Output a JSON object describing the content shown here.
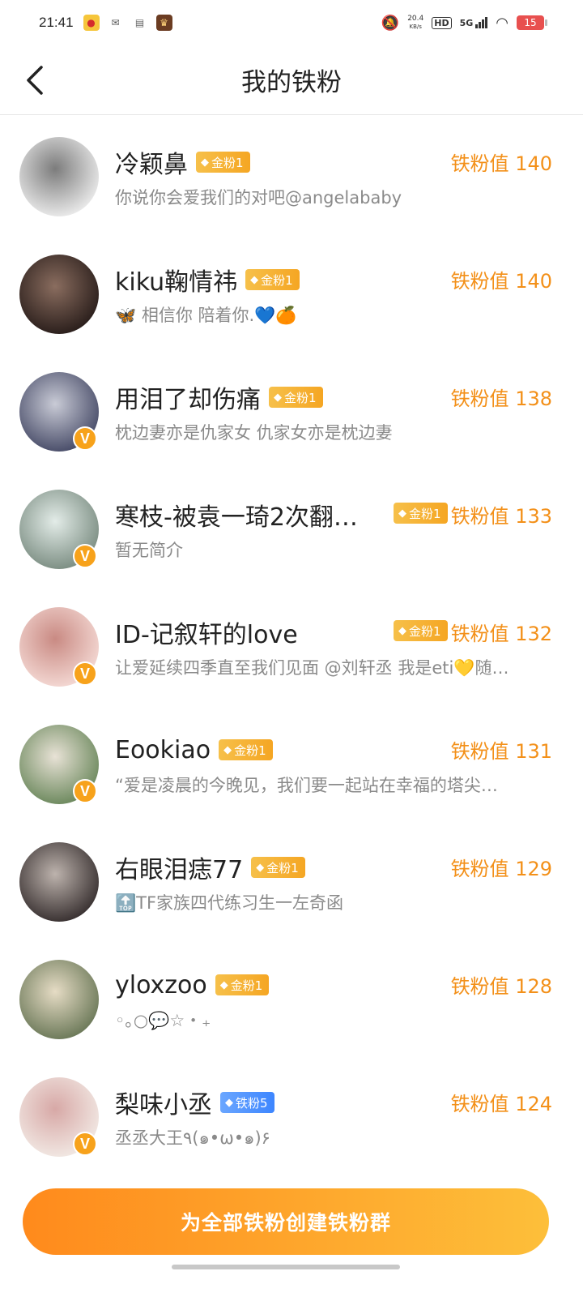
{
  "status_bar": {
    "time": "21:41",
    "speed_value": "20.4",
    "speed_unit": "KB/s",
    "hd": "HD",
    "network": "5G",
    "battery": "15"
  },
  "header": {
    "title": "我的铁粉",
    "back_icon": "chevron-left-icon"
  },
  "fans": [
    {
      "name": "冷颖鼻",
      "badge": "金粉1",
      "badge_type": "gold",
      "score": "铁粉值 140",
      "bio": "你说你会爱我们的对吧@angelababy",
      "verified": false,
      "avatar_colors": [
        "#e9e9e9",
        "#7c7c7c"
      ]
    },
    {
      "name": "kiku鞠情祎",
      "badge": "金粉1",
      "badge_type": "gold",
      "score": "铁粉值 140",
      "bio": "🦋 相信你 陪着你.💙🍊",
      "verified": false,
      "avatar_colors": [
        "#2b1f1c",
        "#8a6d5f"
      ]
    },
    {
      "name": "用泪了却伤痛",
      "badge": "金粉1",
      "badge_type": "gold",
      "score": "铁粉值 138",
      "bio": "枕边妻亦是仇家女 仇家女亦是枕边妻",
      "verified": true,
      "avatar_colors": [
        "#4a4e6a",
        "#c9cbd6"
      ]
    },
    {
      "name": "寒枝-被袁一琦2次翻…",
      "badge": "金粉1",
      "badge_type": "gold",
      "score": "铁粉值 133",
      "bio": "暂无简介",
      "verified": true,
      "avatar_colors": [
        "#7d8f84",
        "#e3ece8"
      ]
    },
    {
      "name": "ID-记叙轩的love",
      "badge": "金粉1",
      "badge_type": "gold",
      "score": "铁粉值 132",
      "bio": "让爱延续四季直至我们见面 @刘轩丞 我是eti💛随…",
      "verified": true,
      "avatar_colors": [
        "#f3d7d2",
        "#c98a83"
      ]
    },
    {
      "name": "Eookiao",
      "badge": "金粉1",
      "badge_type": "gold",
      "score": "铁粉值 131",
      "bio": "“爱是凌晨的今晚见，我们要一起站在幸福的塔尖…",
      "verified": true,
      "avatar_colors": [
        "#6e8a5f",
        "#e8e2d6"
      ]
    },
    {
      "name": "右眼泪痣77",
      "badge": "金粉1",
      "badge_type": "gold",
      "score": "铁粉值 129",
      "bio": "🔝TF家族四代练习生一左奇函",
      "verified": false,
      "avatar_colors": [
        "#3a3232",
        "#bdb3ad"
      ]
    },
    {
      "name": "yloxzoo",
      "badge": "金粉1",
      "badge_type": "gold",
      "score": "铁粉值 128",
      "bio": "◦｡○💬☆・₊",
      "verified": false,
      "avatar_colors": [
        "#6d7a5a",
        "#e6dcc5"
      ]
    },
    {
      "name": "梨味小丞",
      "badge": "铁粉5",
      "badge_type": "blue",
      "score": "铁粉值 124",
      "bio": "丞丞大王٩(๑•ω•๑)۶",
      "verified": true,
      "avatar_colors": [
        "#f1e7e2",
        "#d7a8a6"
      ]
    }
  ],
  "cta": {
    "label": "为全部铁粉创建铁粉群"
  }
}
